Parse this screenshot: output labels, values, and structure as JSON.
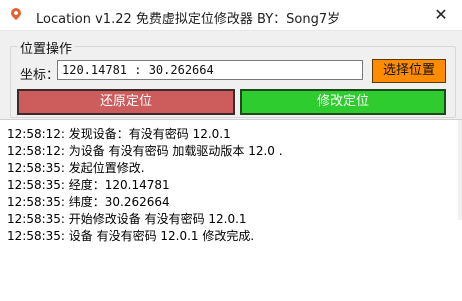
{
  "window": {
    "title": "Location v1.22 免费虚拟定位修改器 BY：Song7岁",
    "close_glyph": "✕",
    "icon": "location-pin-icon"
  },
  "location_group": {
    "legend": "位置操作",
    "coord_label": "坐标：",
    "coord_value": "120.14781 : 30.262664",
    "select_button": "选择位置",
    "restore_button": "还原定位",
    "modify_button": "修改定位"
  },
  "colors": {
    "select_button": "#ff8c00",
    "restore_button": "#cd5c5c",
    "modify_button": "#2ecc2e"
  },
  "log": {
    "lines": [
      "12:58:12:  发现设备：有没有密码  12.0.1",
      "12:58:12:  为设备 有没有密码  加载驱动版本 12.0 .",
      "12:58:35:  发起位置修改.",
      "12:58:35:  经度：120.14781",
      "12:58:35:  纬度：30.262664",
      "12:58:35:  开始修改设备 有没有密码  12.0.1",
      "12:58:35:  设备 有没有密码  12.0.1 修改完成."
    ]
  }
}
